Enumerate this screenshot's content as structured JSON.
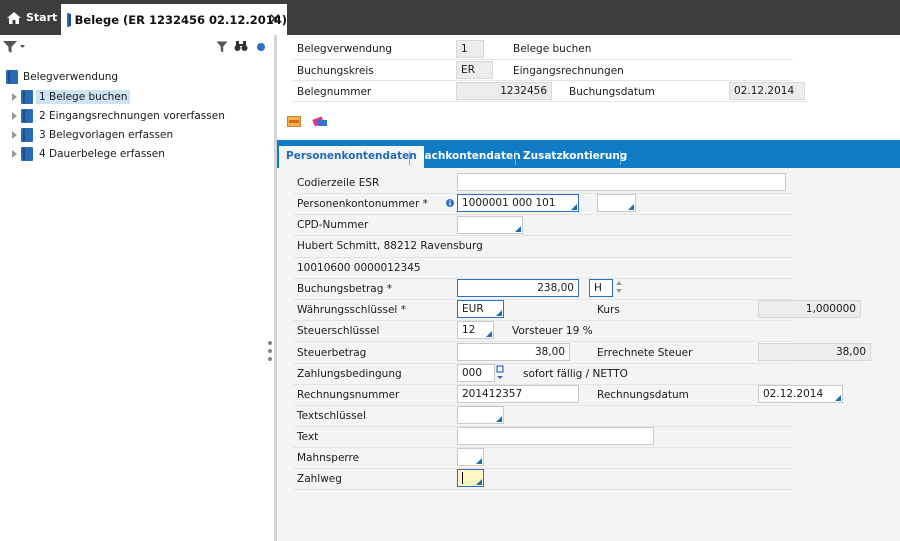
{
  "tabs": {
    "start_label": "Start",
    "doc_label": "Belege (ER 1232456 02.12.2014)"
  },
  "tree": {
    "root": "Belegverwendung",
    "items": [
      {
        "label": "1 Belege buchen",
        "selected": true
      },
      {
        "label": "2 Eingangsrechnungen vorerfassen",
        "selected": false
      },
      {
        "label": "3 Belegvorlagen erfassen",
        "selected": false
      },
      {
        "label": "4 Dauerbelege erfassen",
        "selected": false
      }
    ]
  },
  "header": {
    "belegverwendung_label": "Belegverwendung",
    "belegverwendung_value": "1",
    "belegverwendung_text": "Belege buchen",
    "buchungskreis_label": "Buchungskreis",
    "buchungskreis_value": "ER",
    "buchungskreis_text": "Eingangsrechnungen",
    "belegnummer_label": "Belegnummer",
    "belegnummer_value": "1232456",
    "buchungsdatum_label": "Buchungsdatum",
    "buchungsdatum_value": "02.12.2014"
  },
  "form_tabs": [
    "Personenkontendaten",
    "Sachkontendaten",
    "Zusatzkontierung"
  ],
  "form": {
    "codierzeile_label": "Codierzeile ESR",
    "codierzeile_value": "",
    "personenkonto_label": "Personenkontonummer *",
    "personenkonto_value": "1000001 000 101",
    "cpd_label": "CPD-Nummer",
    "cpd_value": "",
    "address_line": "Hubert Schmitt, 88212 Ravensburg",
    "bank_line": "10010600 0000012345",
    "buchungsbetrag_label": "Buchungsbetrag *",
    "buchungsbetrag_value": "238,00",
    "soll_haben_value": "H",
    "waehrung_label": "Währungsschlüssel *",
    "waehrung_value": "EUR",
    "kurs_label": "Kurs",
    "kurs_value": "1,000000",
    "steuerschluessel_label": "Steuerschlüssel",
    "steuerschluessel_value": "12",
    "steuerschluessel_text": "Vorsteuer 19 %",
    "steuerbetrag_label": "Steuerbetrag",
    "steuerbetrag_value": "38,00",
    "errechnete_steuer_label": "Errechnete Steuer",
    "errechnete_steuer_value": "38,00",
    "zahlungsbedingung_label": "Zahlungsbedingung",
    "zahlungsbedingung_value": "000",
    "zahlungsbedingung_text": "sofort fällig / NETTO",
    "rechnungsnummer_label": "Rechnungsnummer",
    "rechnungsnummer_value": "201412357",
    "rechnungsdatum_label": "Rechnungsdatum",
    "rechnungsdatum_value": "02.12.2014",
    "textschluessel_label": "Textschlüssel",
    "textschluessel_value": "",
    "text_label": "Text",
    "text_value": "",
    "mahnsperre_label": "Mahnsperre",
    "mahnsperre_value": "",
    "zahlweg_label": "Zahlweg",
    "zahlweg_value": ""
  },
  "colors": {
    "topbar": "#3d3d3d",
    "tabbar": "#0f7bc4",
    "accent": "#1f6db5",
    "selected_tree": "#cfe2f5",
    "focus_field": "#fdf7c6"
  }
}
